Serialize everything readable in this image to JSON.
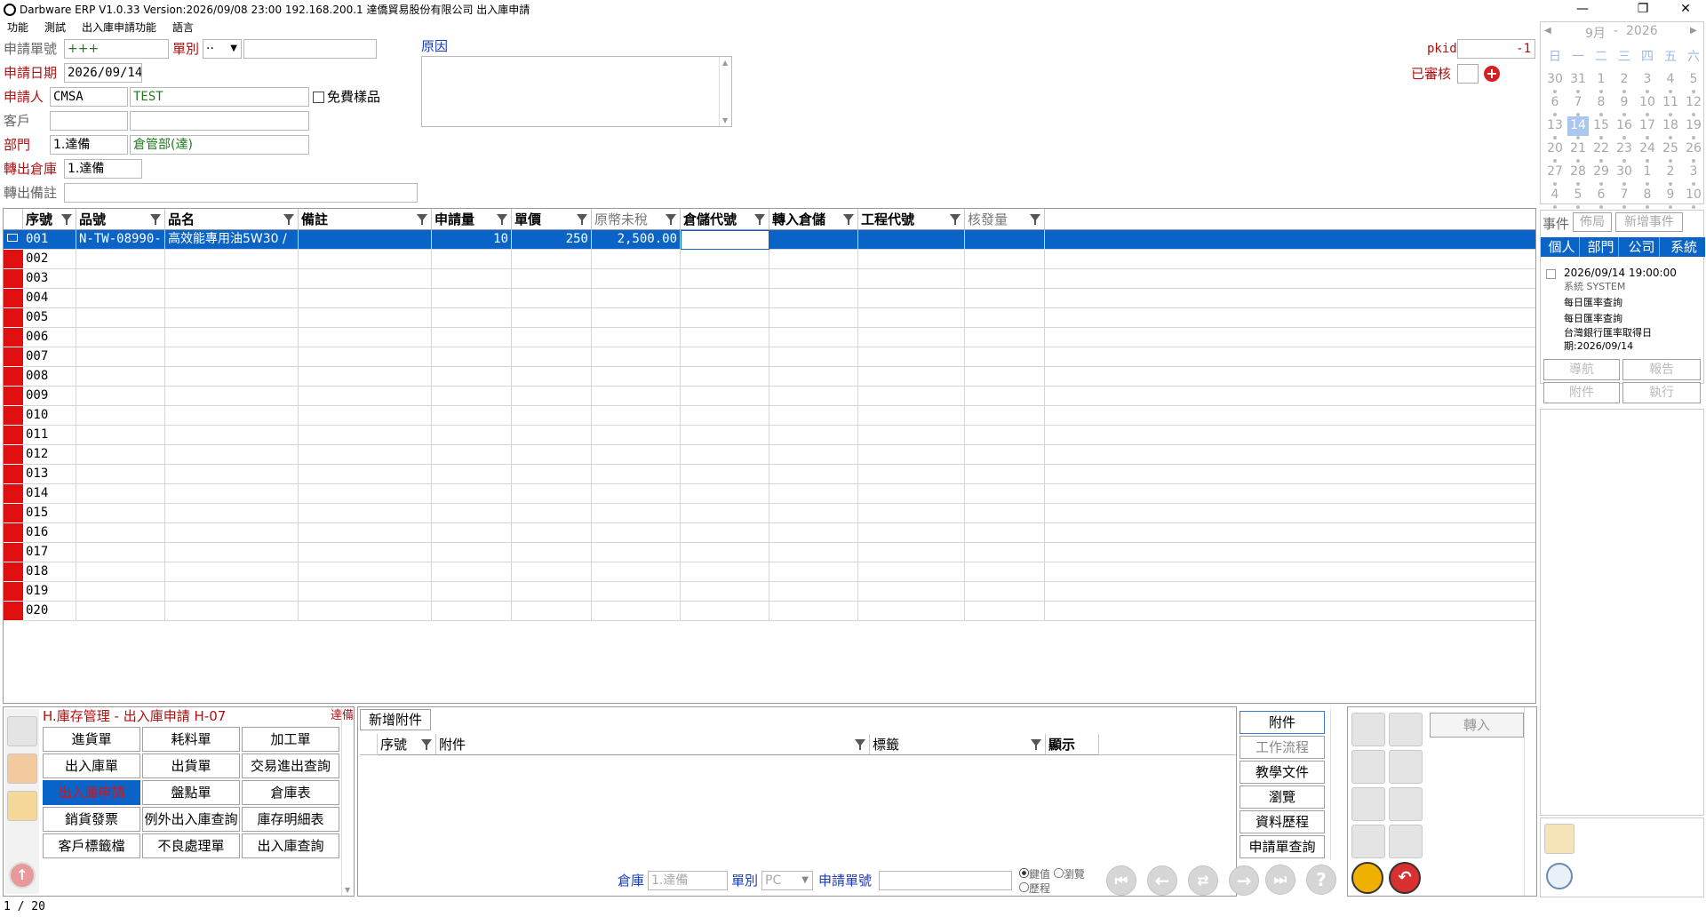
{
  "window": {
    "title": "Darbware ERP V1.0.33 Version:2026/09/08 23:00   192.168.200.1 達僑貿易股份有限公司 出入庫申請",
    "minimize": "—",
    "restore": "❐",
    "close": "✕"
  },
  "menu": [
    "功能",
    "測試",
    "出入庫申請功能",
    "語言"
  ],
  "form": {
    "req_no_label": "申請單號",
    "req_no": "+++",
    "type_label": "單別",
    "type_value": "··",
    "req_date_label": "申請日期",
    "req_date": "2026/09/14",
    "applicant_label": "申請人",
    "applicant_code": "CMSA",
    "applicant_name": "TEST",
    "free_sample_label": "免費樣品",
    "customer_label": "客戶",
    "dept_label": "部門",
    "dept_code": "1.達備",
    "dept_name": "倉管部(達)",
    "out_wh_label": "轉出倉庫",
    "out_wh": "1.達備",
    "out_note_label": "轉出備註",
    "reason_label": "原因",
    "pkid_label": "pkid",
    "pkid": "-1",
    "reviewed_label": "已審核"
  },
  "grid": {
    "columns": [
      "序號",
      "品號",
      "品名",
      "備註",
      "申請量",
      "單價",
      "原幣未稅",
      "倉儲代號",
      "轉入倉儲",
      "工程代號",
      "核發量"
    ],
    "rows": [
      {
        "seq": "001",
        "item_no": "N-TW-08990-",
        "item_name": "高效能專用油5W30 /",
        "note": "",
        "qty": "10",
        "price": "250",
        "amount": "2,500.00"
      },
      {
        "seq": "002"
      },
      {
        "seq": "003"
      },
      {
        "seq": "004"
      },
      {
        "seq": "005"
      },
      {
        "seq": "006"
      },
      {
        "seq": "007"
      },
      {
        "seq": "008"
      },
      {
        "seq": "009"
      },
      {
        "seq": "010"
      },
      {
        "seq": "011"
      },
      {
        "seq": "012"
      },
      {
        "seq": "013"
      },
      {
        "seq": "014"
      },
      {
        "seq": "015"
      },
      {
        "seq": "016"
      },
      {
        "seq": "017"
      },
      {
        "seq": "018"
      },
      {
        "seq": "019"
      },
      {
        "seq": "020"
      }
    ]
  },
  "module": {
    "title": "H.庫存管理 - 出入庫申請  H-07",
    "company": "達備",
    "buttons": [
      "進貨單",
      "耗料單",
      "加工單",
      "出入庫單",
      "出貨單",
      "交易進出查詢",
      "出入庫申請",
      "盤點單",
      "倉庫表",
      "銷貨發票",
      "例外出入庫查詢",
      "庫存明細表",
      "客戶標籤檔",
      "不良處理單",
      "出入庫查詢"
    ],
    "active_button": "出入庫申請"
  },
  "attach": {
    "add_button": "新增附件",
    "columns": [
      "序號",
      "附件",
      "標籤",
      "顯示"
    ],
    "side_buttons": [
      "附件",
      "工作流程",
      "教學文件",
      "瀏覽",
      "資料歷程",
      "申請單查詢"
    ]
  },
  "footer": {
    "wh_label": "倉庫",
    "wh_value": "1.達備",
    "type_label": "單別",
    "type_value": "PC",
    "req_no_label": "申請單號",
    "mode_options": [
      "鍵值",
      "瀏覽",
      "歷程"
    ]
  },
  "transfer_button": "轉入",
  "status": "1 / 20",
  "calendar": {
    "month": "9月",
    "year": "2026",
    "weekdays": [
      "日",
      "一",
      "二",
      "三",
      "四",
      "五",
      "六"
    ],
    "weeks": [
      [
        "30",
        "31",
        "1",
        "2",
        "3",
        "4",
        "5"
      ],
      [
        "6",
        "7",
        "8",
        "9",
        "10",
        "11",
        "12"
      ],
      [
        "13",
        "14",
        "15",
        "16",
        "17",
        "18",
        "19"
      ],
      [
        "20",
        "21",
        "22",
        "23",
        "24",
        "25",
        "26"
      ],
      [
        "27",
        "28",
        "29",
        "30",
        "1",
        "2",
        "3"
      ],
      [
        "4",
        "5",
        "6",
        "7",
        "8",
        "9",
        "10"
      ]
    ],
    "today": "14"
  },
  "events": {
    "label": "事件",
    "layout_btn": "佈局",
    "add_btn": "新增事件",
    "tabs": [
      "個人",
      "部門",
      "公司",
      "系統"
    ],
    "item": {
      "datetime": "2026/09/14 19:00:00",
      "sender": "系統  SYSTEM",
      "title": "每日匯率查詢",
      "body": "每日匯率查詢",
      "detail": "台灣銀行匯率取得日期:2026/09/14"
    },
    "actions": [
      "導航",
      "報告",
      "附件",
      "執行"
    ]
  },
  "colors": {
    "accent": "#0a64c8",
    "indicator": "#e01010",
    "label_red": "#b01010"
  }
}
